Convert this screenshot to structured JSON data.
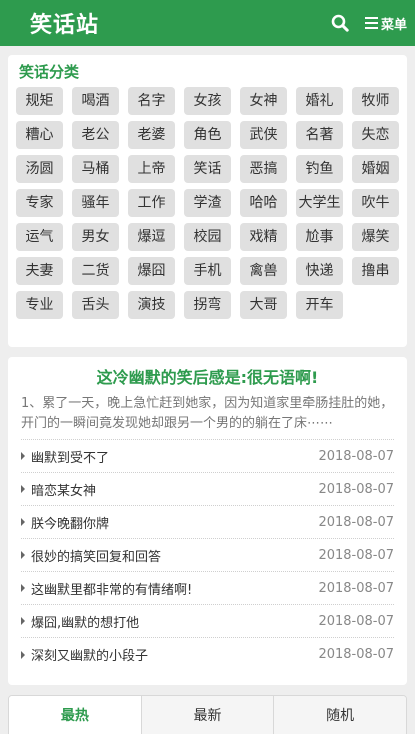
{
  "header": {
    "logo": "笑话站",
    "menu_label": "菜单"
  },
  "categories": {
    "title": "笑话分类",
    "tags": [
      "规矩",
      "喝酒",
      "名字",
      "女孩",
      "女神",
      "婚礼",
      "牧师",
      "糟心",
      "老公",
      "老婆",
      "角色",
      "武侠",
      "名著",
      "失恋",
      "汤圆",
      "马桶",
      "上帝",
      "笑话",
      "恶搞",
      "钓鱼",
      "婚姻",
      "专家",
      "骚年",
      "工作",
      "学渣",
      "哈哈",
      "大学生",
      "吹牛",
      "运气",
      "男女",
      "爆逗",
      "校园",
      "戏精",
      "尬事",
      "爆笑",
      "夫妻",
      "二货",
      "爆囧",
      "手机",
      "禽兽",
      "快递",
      "撸串",
      "专业",
      "舌头",
      "演技",
      "拐弯",
      "大哥",
      "开车"
    ]
  },
  "article": {
    "title": "这冷幽默的笑后感是:很无语啊!",
    "excerpt": "1、累了一天，晚上急忙赶到她家，因为知道家里牵肠挂肚的她，开门的一瞬间竟发现她却跟另一个男的的躺在了床⋯⋯"
  },
  "list": [
    {
      "title": "幽默到受不了",
      "date": "2018-08-07"
    },
    {
      "title": "暗恋某女神",
      "date": "2018-08-07"
    },
    {
      "title": "朕今晚翻你牌",
      "date": "2018-08-07"
    },
    {
      "title": "很妙的搞笑回复和回答",
      "date": "2018-08-07"
    },
    {
      "title": "这幽默里都非常的有情绪啊!",
      "date": "2018-08-07"
    },
    {
      "title": "爆囧,幽默的想打他",
      "date": "2018-08-07"
    },
    {
      "title": "深刻又幽默的小段子",
      "date": "2018-08-07"
    }
  ],
  "tabs": [
    {
      "label": "最热",
      "active": true
    },
    {
      "label": "最新",
      "active": false
    },
    {
      "label": "随机",
      "active": false
    }
  ],
  "colors": {
    "brand_green": "#2e9b4e"
  },
  "icons": {
    "search": "search-icon",
    "menu": "menu-icon",
    "list_marker": "triangle-right-icon"
  }
}
